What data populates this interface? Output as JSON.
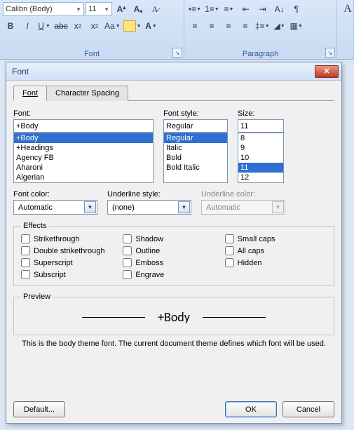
{
  "ribbon": {
    "font_group_label": "Font",
    "paragraph_group_label": "Paragraph",
    "font_name": "Calibri (Body)",
    "font_size": "11"
  },
  "dialog": {
    "title": "Font",
    "tabs": {
      "font": "Font",
      "spacing": "Character Spacing"
    },
    "labels": {
      "font": "Font:",
      "font_style": "Font style:",
      "size": "Size:",
      "font_color": "Font color:",
      "underline_style": "Underline style:",
      "underline_color": "Underline color:"
    },
    "font_value": "+Body",
    "font_list": [
      "+Body",
      "+Headings",
      "Agency FB",
      "Aharoni",
      "Algerian"
    ],
    "font_selected": "+Body",
    "style_value": "Regular",
    "style_list": [
      "Regular",
      "Italic",
      "Bold",
      "Bold Italic"
    ],
    "style_selected": "Regular",
    "size_value": "11",
    "size_list": [
      "8",
      "9",
      "10",
      "11",
      "12"
    ],
    "size_selected": "11",
    "font_color_value": "Automatic",
    "underline_style_value": "(none)",
    "underline_color_value": "Automatic",
    "effects_legend": "Effects",
    "effects": {
      "strikethrough": "Strikethrough",
      "double_strikethrough": "Double strikethrough",
      "superscript": "Superscript",
      "subscript": "Subscript",
      "shadow": "Shadow",
      "outline": "Outline",
      "emboss": "Emboss",
      "engrave": "Engrave",
      "small_caps": "Small caps",
      "all_caps": "All caps",
      "hidden": "Hidden"
    },
    "preview_legend": "Preview",
    "preview_sample": "+Body",
    "preview_note": "This is the body theme font. The current document theme defines which font will be used.",
    "buttons": {
      "default": "Default...",
      "ok": "OK",
      "cancel": "Cancel"
    }
  }
}
